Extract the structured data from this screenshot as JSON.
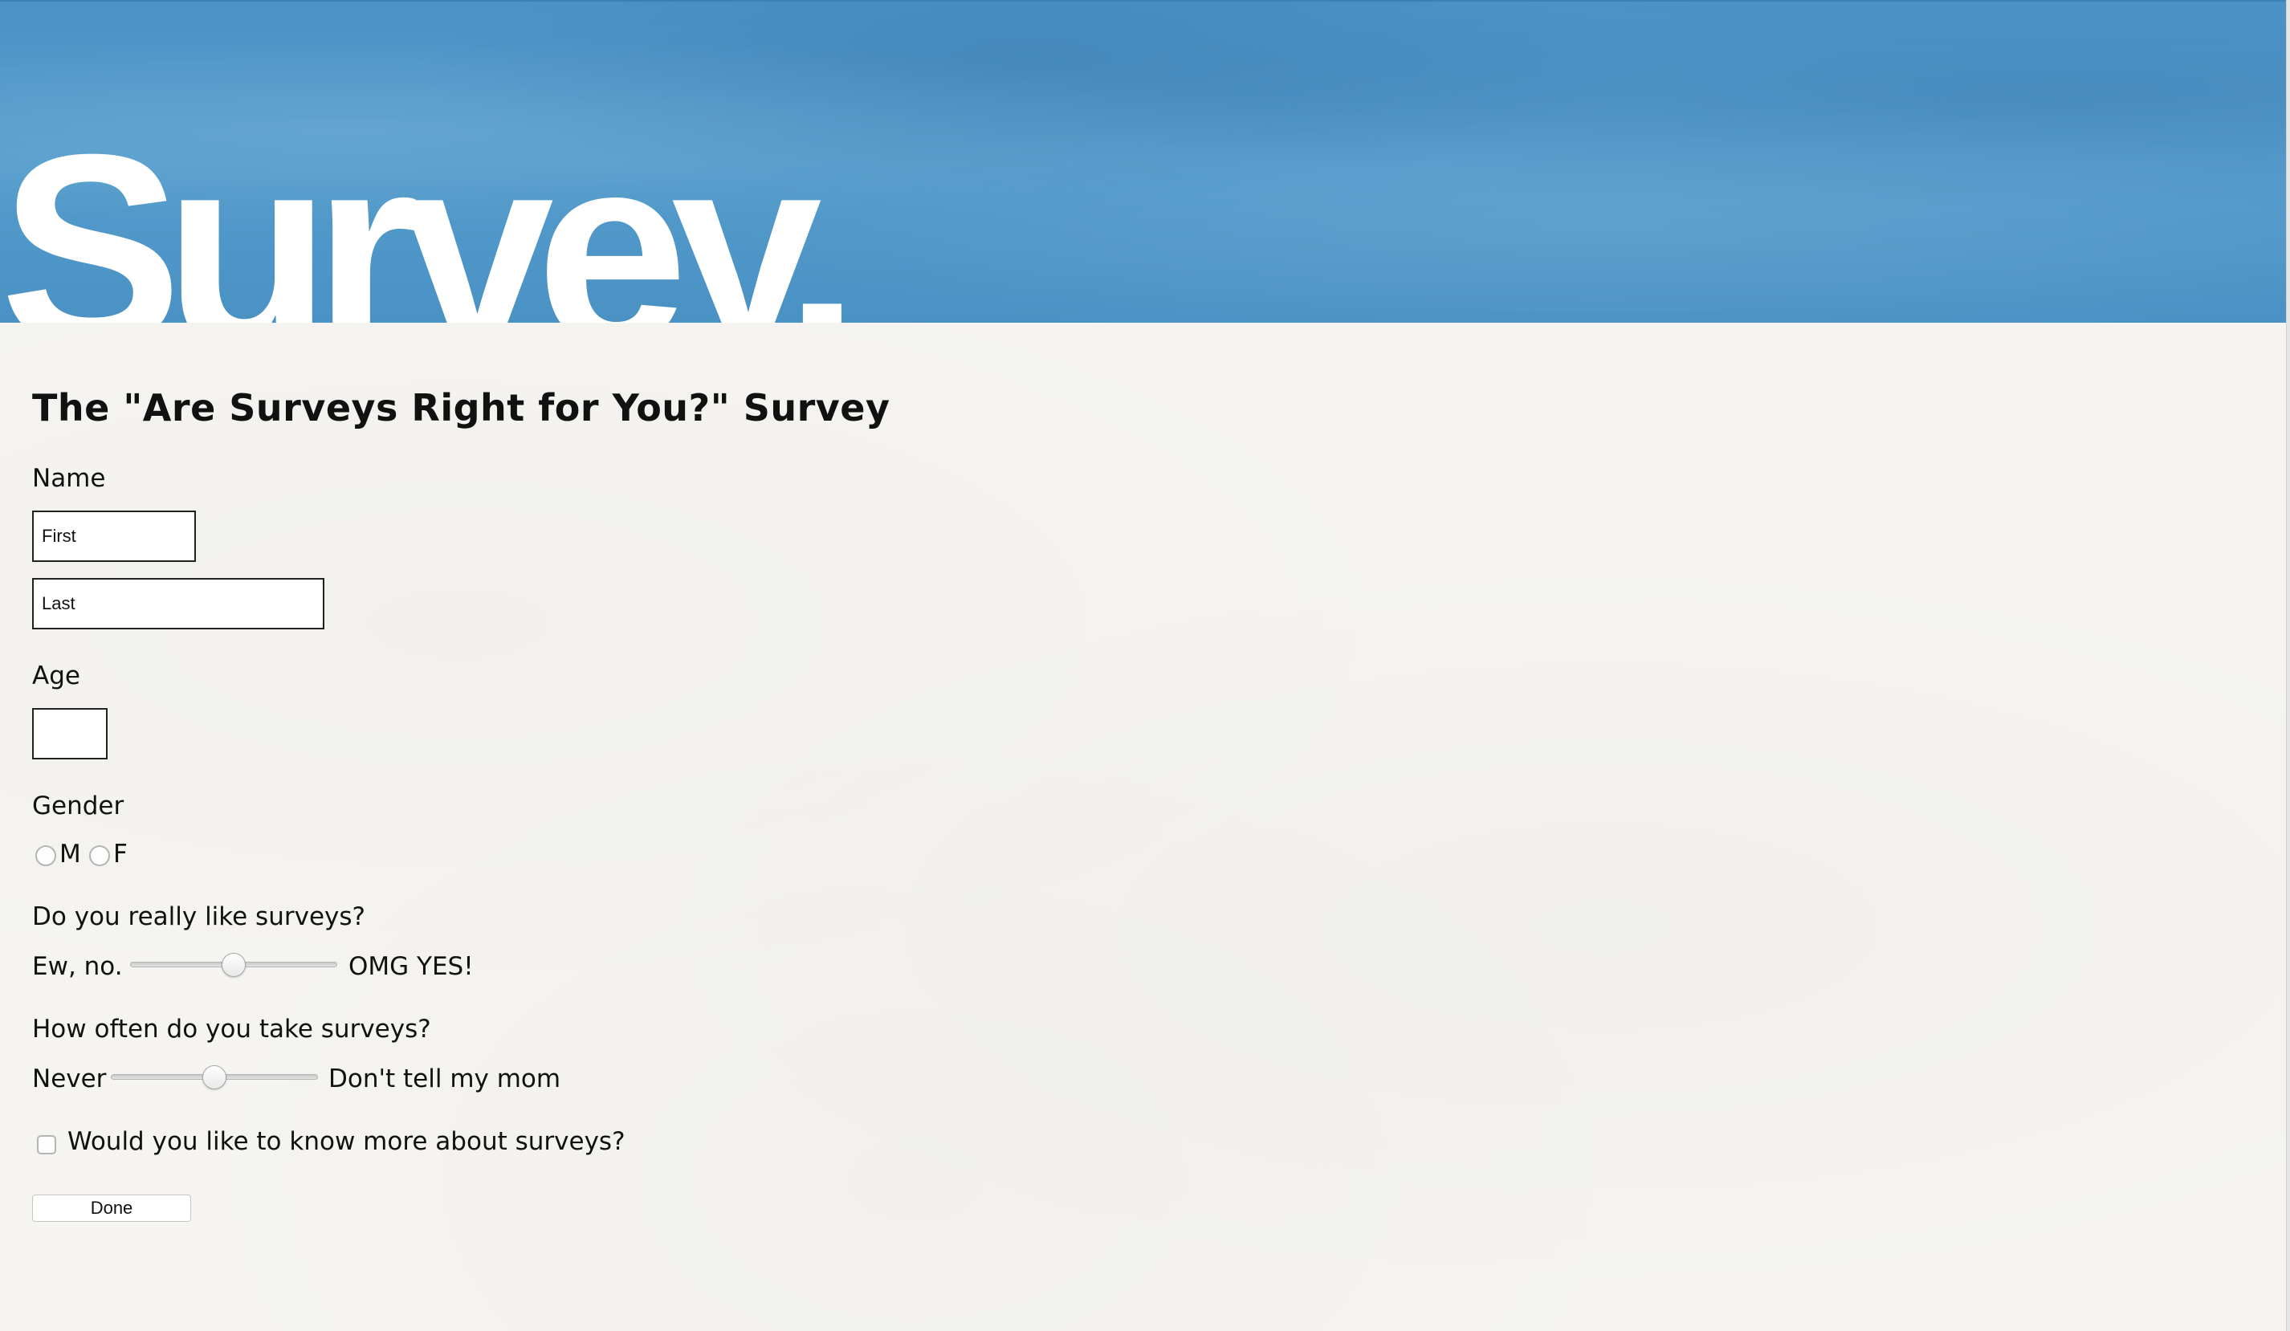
{
  "banner": {
    "title": "Survey."
  },
  "survey": {
    "title": "The \"Are Surveys Right for You?\" Survey"
  },
  "name": {
    "label": "Name",
    "first_placeholder": "First",
    "last_placeholder": "Last"
  },
  "age": {
    "label": "Age",
    "value": ""
  },
  "gender": {
    "label": "Gender",
    "options": [
      "M",
      "F"
    ],
    "selected": null
  },
  "like_surveys": {
    "question": "Do you really like surveys?",
    "min_label": "Ew, no.",
    "max_label": "OMG YES!",
    "value_fraction": 0.5
  },
  "frequency": {
    "question": "How often do you take surveys?",
    "min_label": "Never",
    "max_label": "Don't tell my mom",
    "value_fraction": 0.5
  },
  "more_info": {
    "label": "Would you like to know more about surveys?",
    "checked": false
  },
  "submit": {
    "label": "Done"
  },
  "colors": {
    "banner_blue": "#4f97c9",
    "paper": "#f5f4f0",
    "banner_text": "#ffffff"
  }
}
